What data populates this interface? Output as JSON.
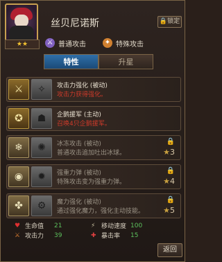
{
  "hero": {
    "name": "丝贝尼诺斯",
    "stars": "★★",
    "lock_label": "锁定",
    "attack_types": [
      {
        "label": "普通攻击",
        "icon": "sword-icon"
      },
      {
        "label": "特殊攻击",
        "icon": "magic-icon"
      }
    ]
  },
  "tabs": [
    {
      "label": "特性",
      "active": true
    },
    {
      "label": "升星",
      "active": false
    }
  ],
  "skills": [
    {
      "name": "攻击力强化 (被动)",
      "desc": "攻击力获得强化。",
      "locked": false,
      "req": ""
    },
    {
      "name": "企鹅援军 (主动)",
      "desc": "召唤4只企鹅援军。",
      "locked": false,
      "req": ""
    },
    {
      "name": "冰冻攻击 (被动)",
      "desc": "普通攻击追加吐出冰球。",
      "locked": true,
      "req": "3"
    },
    {
      "name": "强重力弹 (被动)",
      "desc": "特殊攻击变为强重力弹。",
      "locked": true,
      "req": "4"
    },
    {
      "name": "魔力强化 (被动)",
      "desc": "通过强化魔力，强化主动技能。",
      "locked": true,
      "req": "5"
    }
  ],
  "stats": [
    {
      "label": "生命值",
      "value": "21",
      "icon": "heart-icon"
    },
    {
      "label": "移动速度",
      "value": "100",
      "icon": "boot-icon"
    },
    {
      "label": "攻击力",
      "value": "39",
      "icon": "sword-icon"
    },
    {
      "label": "暴击率",
      "value": "15",
      "icon": "cross-icon"
    }
  ],
  "back_label": "返回",
  "colors": {
    "active_tab": "#2f6fa8",
    "skill_desc_unlocked": "#cc3a2a",
    "stat_value": "#5cc05c",
    "star": "#f2c232"
  }
}
